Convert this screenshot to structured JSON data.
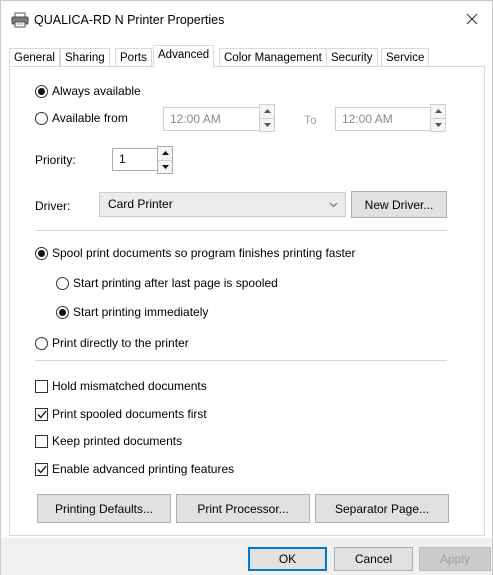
{
  "window": {
    "title": "QUALICA-RD N Printer Properties"
  },
  "tabs": [
    {
      "label": "General"
    },
    {
      "label": "Sharing"
    },
    {
      "label": "Ports"
    },
    {
      "label": "Advanced"
    },
    {
      "label": "Color Management"
    },
    {
      "label": "Security"
    },
    {
      "label": "Service"
    }
  ],
  "active_tab": "Advanced",
  "availability": {
    "always_label": "Always available",
    "always_selected": true,
    "from_label": "Available from",
    "from_selected": false,
    "from_time": "12:00 AM",
    "to_label": "To",
    "to_time": "12:00 AM"
  },
  "priority": {
    "label": "Priority:",
    "value": "1"
  },
  "driver": {
    "label": "Driver:",
    "selected": "Card Printer",
    "new_driver_label": "New Driver..."
  },
  "spooling": {
    "spool_label": "Spool print documents so program finishes printing faster",
    "spool_selected": true,
    "after_last_page_label": "Start printing after last page is spooled",
    "after_last_page_selected": false,
    "immediately_label": "Start printing immediately",
    "immediately_selected": true,
    "direct_label": "Print directly to the printer",
    "direct_selected": false
  },
  "options": {
    "hold_mismatched": {
      "label": "Hold mismatched documents",
      "checked": false
    },
    "spooled_first": {
      "label": "Print spooled documents first",
      "checked": true
    },
    "keep_printed": {
      "label": "Keep printed documents",
      "checked": false
    },
    "advanced_features": {
      "label": "Enable advanced printing features",
      "checked": true
    }
  },
  "bottom_buttons": {
    "printing_defaults": "Printing Defaults...",
    "print_processor": "Print Processor...",
    "separator_page": "Separator Page..."
  },
  "dialog_buttons": {
    "ok": "OK",
    "cancel": "Cancel",
    "apply": "Apply"
  },
  "colors": {
    "accent": "#0078d7",
    "footer_bg": "#f0f0f0"
  }
}
